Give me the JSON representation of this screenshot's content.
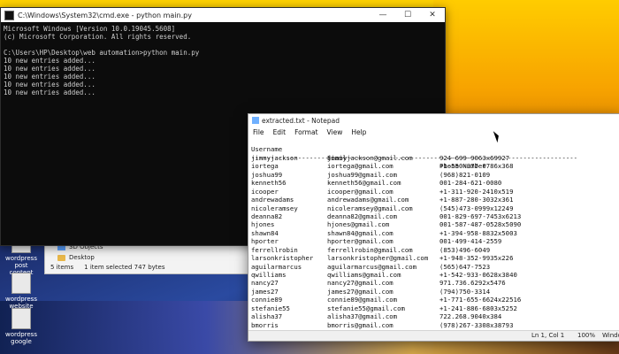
{
  "cmd": {
    "title": "C:\\Windows\\System32\\cmd.exe - python  main.py",
    "lines": [
      "Microsoft Windows [Version 10.0.19045.5608]",
      "(c) Microsoft Corporation. All rights reserved.",
      "",
      "C:\\Users\\HP\\Desktop\\web automation>python main.py",
      "10 new entries added...",
      "10 new entries added...",
      "10 new entries added...",
      "10 new entries added...",
      "10 new entries added..."
    ]
  },
  "desktop_icons": [
    {
      "label": "wordpress post content"
    },
    {
      "label": "wordpress website"
    },
    {
      "label": "wordpress google"
    }
  ],
  "explorer": {
    "items": [
      "3D Objects",
      "Desktop"
    ],
    "status": [
      "5 items",
      "1 item selected  747 bytes"
    ]
  },
  "notepad": {
    "title": "extracted.txt - Notepad",
    "menu": [
      "File",
      "Edit",
      "Format",
      "View",
      "Help"
    ],
    "headers": [
      "Username",
      "Email",
      "Phone Number"
    ],
    "separator": "------------------------------------------------------------------------------------",
    "rows": [
      [
        "jimmyjackson",
        "jimmyjackson@gmail.com",
        "924-699-9063x69927"
      ],
      [
        "iortega",
        "iortega@gmail.com",
        "+1-550-377-0786x368"
      ],
      [
        "joshua99",
        "joshua99@gmail.com",
        "(968)821-0109"
      ],
      [
        "kenneth56",
        "kenneth56@gmail.com",
        "001-284-621-0080"
      ],
      [
        "icooper",
        "icooper@gmail.com",
        "+1-311-920-2410x519"
      ],
      [
        "andrewadams",
        "andrewadams@gmail.com",
        "+1-887-280-3032x361"
      ],
      [
        "nicoleramsey",
        "nicoleramsey@gmail.com",
        "(545)473-0999x12249"
      ],
      [
        "deanna82",
        "deanna82@gmail.com",
        "001-829-697-7453x6213"
      ],
      [
        "hjones",
        "hjones@gmail.com",
        "001-587-487-0528x5090"
      ],
      [
        "shawn84",
        "shawn84@gmail.com",
        "+1-394-958-8832x5003"
      ],
      [
        "hporter",
        "hporter@gmail.com",
        "001-499-414-2559"
      ],
      [
        "ferrellrobin",
        "ferrellrobin@gmail.com",
        "(853)496-6049"
      ],
      [
        "larsonkristopher",
        "larsonkristopher@gmail.com",
        "+1-948-352-9935x226"
      ],
      [
        "aguilarmarcus",
        "aguilarmarcus@gmail.com",
        "(565)647-7523"
      ],
      [
        "qwilliams",
        "qwilliams@gmail.com",
        "+1-542-933-0628x3840"
      ],
      [
        "nancy27",
        "nancy27@gmail.com",
        "971.736.6292x5476"
      ],
      [
        "james27",
        "james27@gmail.com",
        "(794)750-3314"
      ],
      [
        "connie89",
        "connie89@gmail.com",
        "+1-771-655-6624x22516"
      ],
      [
        "stefanie55",
        "stefanie55@gmail.com",
        "+1-241-886-6803x5252"
      ],
      [
        "alisha37",
        "alisha37@gmail.com",
        "722.268.9040x384"
      ],
      [
        "bmorris",
        "bmorris@gmail.com",
        "(978)267-3308x38793"
      ]
    ],
    "status": {
      "position": "Ln 1, Col 1",
      "zoom": "100%",
      "eol": "Windo"
    }
  }
}
